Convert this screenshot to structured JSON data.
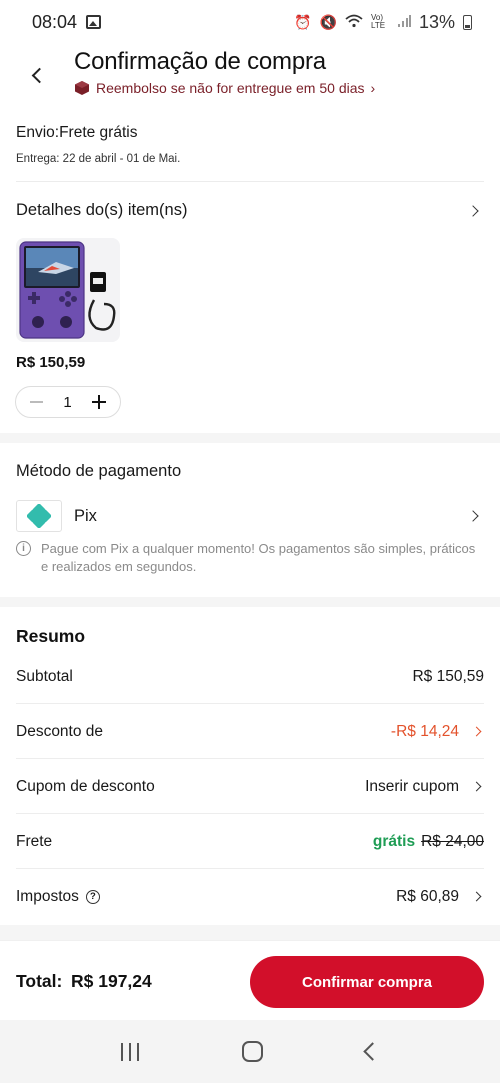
{
  "status_bar": {
    "time": "08:04",
    "network": "Vo) LTE",
    "battery": "13%",
    "icons": [
      "gallery-icon",
      "alarm-icon",
      "mute-icon",
      "wifi-icon",
      "signal-icon",
      "battery-icon"
    ]
  },
  "header": {
    "title": "Confirmação de compra",
    "refund_text": "Reembolso se não for entregue em 50 dias"
  },
  "shipping": {
    "label": "Envio:Frete grátis",
    "delivery": "Entrega: 22 de abril - 01 de Mai."
  },
  "items": {
    "section_title": "Detalhes do(s) item(ns)",
    "product": {
      "price": "R$ 150,59",
      "quantity": "1"
    }
  },
  "payment": {
    "section_title": "Método de pagamento",
    "method": "Pix",
    "note": "Pague com Pix a qualquer momento! Os pagamentos são simples, práticos e realizados em segundos.",
    "accent_color": "#32bcad"
  },
  "summary": {
    "title": "Resumo",
    "subtotal_label": "Subtotal",
    "subtotal_value": "R$ 150,59",
    "discount_label": "Desconto de",
    "discount_value": "-R$ 14,24",
    "coupon_label": "Cupom de desconto",
    "coupon_value": "Inserir cupom",
    "shipping_label": "Frete",
    "shipping_free": "grátis",
    "shipping_original": "R$ 24,00",
    "taxes_label": "Impostos",
    "taxes_value": "R$ 60,89"
  },
  "footer": {
    "total_label": "Total:",
    "total_value": "R$ 197,24",
    "confirm_label": "Confirmar compra",
    "brand_color": "#d20f2a"
  }
}
